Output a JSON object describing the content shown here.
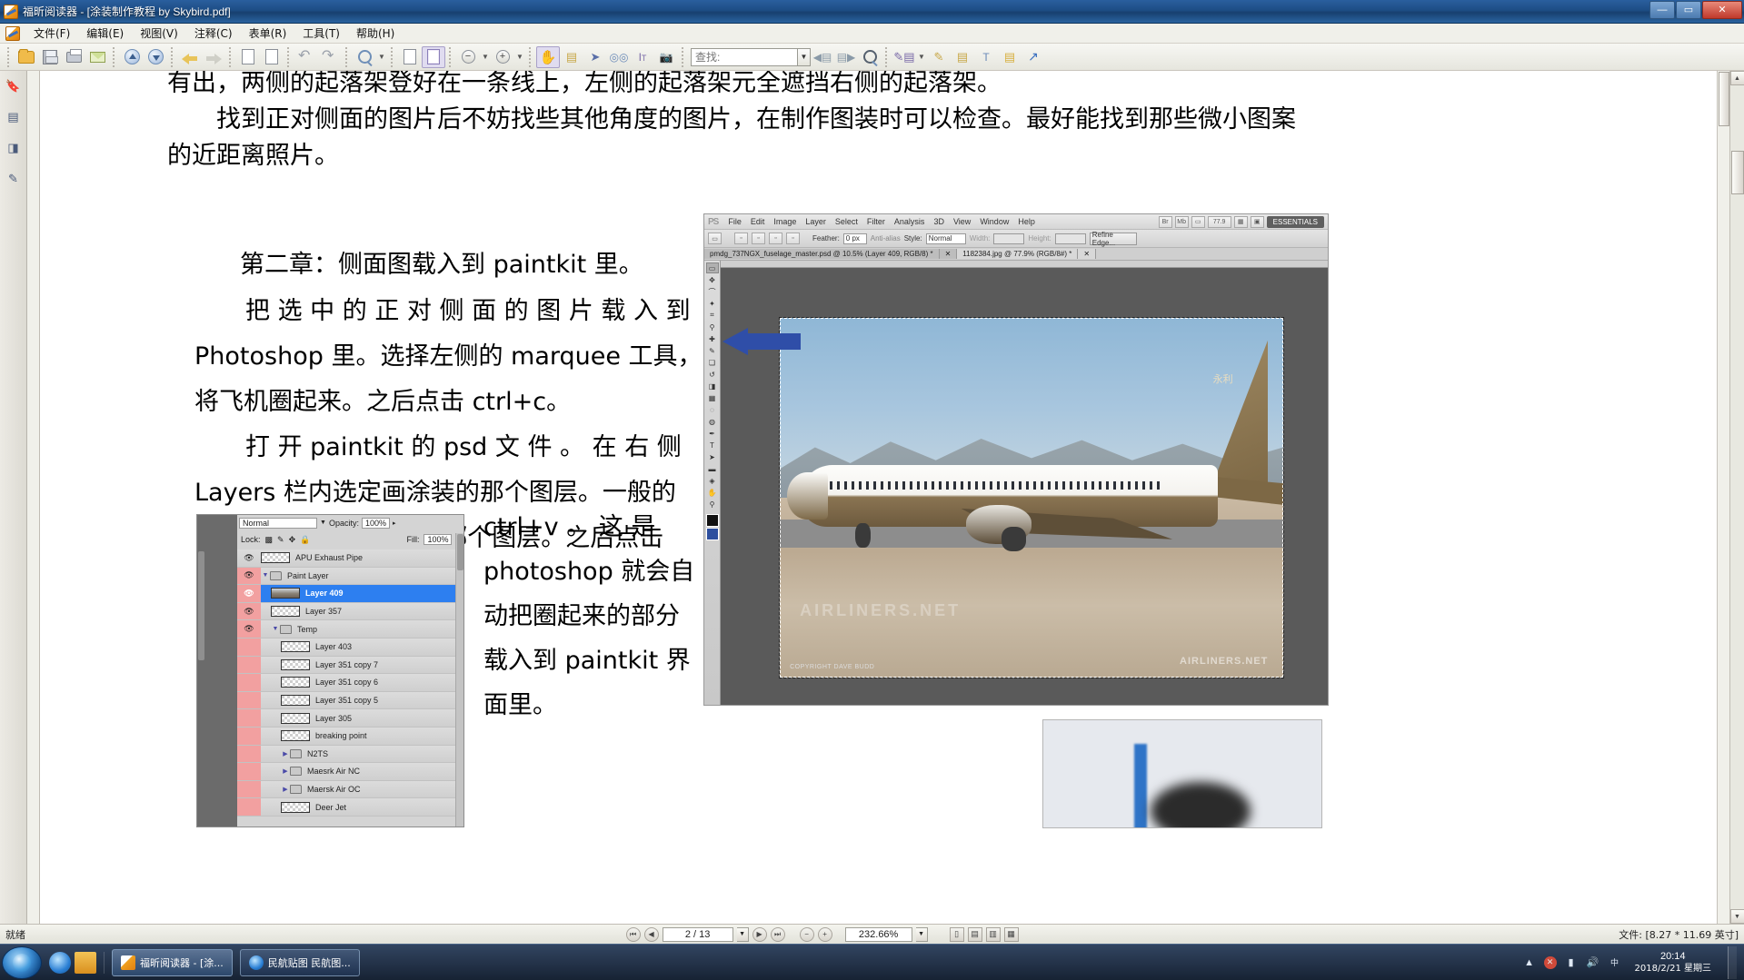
{
  "window": {
    "title": "福昕阅读器 - [涂装制作教程 by Skybird.pdf]",
    "minimize": "—",
    "maximize": "▭",
    "close": "✕"
  },
  "menubar": {
    "items": [
      {
        "label": "文件(F)"
      },
      {
        "label": "编辑(E)"
      },
      {
        "label": "视图(V)"
      },
      {
        "label": "注释(C)"
      },
      {
        "label": "表单(R)"
      },
      {
        "label": "工具(T)"
      },
      {
        "label": "帮助(H)"
      }
    ]
  },
  "toolbar": {
    "search_placeholder": "查找:",
    "search_value": "",
    "buttons": [
      {
        "name": "open-file-icon"
      },
      {
        "name": "save-icon"
      },
      {
        "name": "print-icon"
      },
      {
        "name": "email-icon"
      },
      {
        "name": "previous-page-icon"
      },
      {
        "name": "next-page-icon"
      },
      {
        "name": "back-arrow-icon"
      },
      {
        "name": "forward-arrow-icon"
      },
      {
        "name": "insert-page-icon"
      },
      {
        "name": "extract-page-icon"
      },
      {
        "name": "undo-icon"
      },
      {
        "name": "redo-icon"
      },
      {
        "name": "zoom-tool-icon"
      },
      {
        "name": "fit-page-icon"
      },
      {
        "name": "fit-width-icon"
      },
      {
        "name": "zoom-out-icon"
      },
      {
        "name": "zoom-in-icon"
      },
      {
        "name": "hand-tool-icon"
      },
      {
        "name": "snapshot-marquee-icon"
      },
      {
        "name": "select-tool-icon"
      },
      {
        "name": "binocular-icon"
      },
      {
        "name": "text-select-icon"
      },
      {
        "name": "camera-snapshot-icon"
      },
      {
        "name": "find-previous-icon"
      },
      {
        "name": "find-next-icon"
      },
      {
        "name": "search-magnifier-icon"
      },
      {
        "name": "typewriter-icon"
      },
      {
        "name": "highlight-icon"
      },
      {
        "name": "note-pencil-icon"
      },
      {
        "name": "text-box-icon"
      },
      {
        "name": "sticky-note-icon"
      },
      {
        "name": "link-arrow-icon"
      }
    ]
  },
  "sidebar": {
    "items": [
      {
        "name": "bookmark-panel-icon",
        "glyph": "🔖"
      },
      {
        "name": "page-thumbnails-icon",
        "glyph": "▤"
      },
      {
        "name": "layers-panel-icon",
        "glyph": "◨"
      },
      {
        "name": "comments-panel-icon",
        "glyph": "✎"
      }
    ]
  },
  "document": {
    "lines": [
      "有出，两侧的起落架登好在一条线上，左侧的起落架元全遮挡右侧的起落架。",
      "　　找到正对侧面的图片后不妨找些其他角度的图片，在制作图装时可以检查。最好能找到那些微小图案",
      "的近距离照片。"
    ],
    "chapter_title": "第二章：侧面图载入到 paintkit 里。",
    "body_lines": [
      "把 选 中 的 正 对 侧 面 的 图 片 载 入 到",
      "Photoshop 里。选择左侧的 marquee 工具，",
      "将飞机圈起来。之后点击 ctrl+c。",
      "打 开 paintkit 的 psd 文 件 。 在 右 侧",
      "Layers 栏内选定画涂装的那个图层。一般的",
      "paintkit 都有标明这是哪个图层。之后点击"
    ],
    "right_column_lines": [
      "ctrl+v 。 这 是",
      "photoshop 就会自",
      "动把圈起来的部分",
      "载入到 paintkit 界",
      "面里。"
    ]
  },
  "photoshop": {
    "logo": "PS",
    "menu": [
      "File",
      "Edit",
      "Image",
      "Layer",
      "Select",
      "Filter",
      "Analysis",
      "3D",
      "View",
      "Window",
      "Help"
    ],
    "workspace": "ESSENTIALS",
    "zoom_field": "77.9",
    "options": {
      "feather_label": "Feather:",
      "feather_value": "0 px",
      "antialias_label": "Anti-alias",
      "style_label": "Style:",
      "style_value": "Normal",
      "width_label": "Width:",
      "height_label": "Height:",
      "refine_edge": "Refine Edge..."
    },
    "tabs": [
      {
        "label": "pmdg_737NGX_fuselage_master.psd @ 10.5% (Layer 409, RGB/8) *",
        "selected": false
      },
      {
        "label": "1182384.jpg @ 77.9% (RGB/8#) *",
        "selected": true
      }
    ],
    "image": {
      "watermark": "AIRLINERS.NET",
      "copyright": "COPYRIGHT DAVE BUDD",
      "corner_mark": "AIRLINERS.NET",
      "tail_text": "永利"
    }
  },
  "layers_panel": {
    "blend_mode": "Normal",
    "opacity_label": "Opacity:",
    "opacity_value": "100%",
    "lock_label": "Lock:",
    "fill_label": "Fill:",
    "fill_value": "100%",
    "layers": [
      {
        "name": "APU Exhaust Pipe",
        "type": "layer",
        "visible": true,
        "pink": false,
        "indent": 0,
        "selected": false
      },
      {
        "name": "Paint Layer",
        "type": "group",
        "visible": true,
        "pink": true,
        "indent": 0,
        "selected": false,
        "expanded": true
      },
      {
        "name": "Layer 409",
        "type": "layer",
        "visible": true,
        "pink": true,
        "indent": 1,
        "selected": true
      },
      {
        "name": "Layer 357",
        "type": "layer",
        "visible": true,
        "pink": true,
        "indent": 1,
        "selected": false
      },
      {
        "name": "Temp",
        "type": "group",
        "visible": true,
        "pink": true,
        "indent": 1,
        "selected": false,
        "expanded": true
      },
      {
        "name": "Layer 403",
        "type": "layer",
        "visible": false,
        "pink": true,
        "indent": 2,
        "selected": false
      },
      {
        "name": "Layer 351 copy 7",
        "type": "layer",
        "visible": false,
        "pink": true,
        "indent": 2,
        "selected": false
      },
      {
        "name": "Layer 351 copy 6",
        "type": "layer",
        "visible": false,
        "pink": true,
        "indent": 2,
        "selected": false
      },
      {
        "name": "Layer 351 copy 5",
        "type": "layer",
        "visible": false,
        "pink": true,
        "indent": 2,
        "selected": false
      },
      {
        "name": "Layer 305",
        "type": "layer",
        "visible": false,
        "pink": true,
        "indent": 2,
        "selected": false
      },
      {
        "name": "breaking point",
        "type": "layer",
        "visible": false,
        "pink": true,
        "indent": 2,
        "selected": false
      },
      {
        "name": "N2TS",
        "type": "group",
        "visible": false,
        "pink": true,
        "indent": 2,
        "selected": false,
        "expanded": false
      },
      {
        "name": "Maesrk Air NC",
        "type": "group",
        "visible": false,
        "pink": true,
        "indent": 2,
        "selected": false,
        "expanded": false
      },
      {
        "name": "Maersk Air OC",
        "type": "group",
        "visible": false,
        "pink": true,
        "indent": 2,
        "selected": false,
        "expanded": false
      },
      {
        "name": "Deer Jet",
        "type": "layer",
        "visible": false,
        "pink": true,
        "indent": 2,
        "selected": false
      }
    ]
  },
  "statusbar": {
    "ready": "就绪",
    "page_current": "2 / 13",
    "zoom_value": "232.66%",
    "file_info": "文件: [8.27 * 11.69 英寸]",
    "first_page_icon": "⏮",
    "prev_page_icon": "◀",
    "next_page_icon": "▶",
    "last_page_icon": "⏭",
    "zoom_out_icon": "−",
    "zoom_in_icon": "+",
    "view_single_icon": "▯",
    "view_continuous_icon": "▤",
    "view_facing_icon": "▥",
    "view_cover_icon": "▦"
  },
  "taskbar": {
    "start_label": "",
    "quick_launch": [
      {
        "name": "ie-icon"
      },
      {
        "name": "folder-icon"
      }
    ],
    "tasks": [
      {
        "label": "福昕阅读器 - [涂...",
        "active": true
      },
      {
        "label": "民航贴图 民航图...",
        "active": false
      }
    ],
    "tray": [
      {
        "name": "chevron-up-icon",
        "glyph": "▲"
      },
      {
        "name": "shield-icon",
        "glyph": "🛡"
      },
      {
        "name": "network-icon",
        "glyph": "▮"
      },
      {
        "name": "volume-icon",
        "glyph": "🔊"
      }
    ],
    "clock_time": "20:14",
    "clock_date": "2018/2/21 星期三"
  },
  "colors": {
    "title_blue": "#1d4d85",
    "selection_blue": "#2d7ff0",
    "pink_lock": "#f2a0a0",
    "arrow_blue": "#2f4ea8"
  }
}
